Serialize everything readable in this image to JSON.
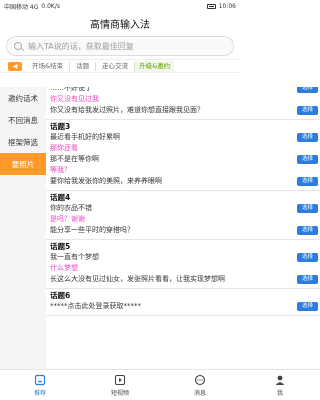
{
  "status_bar": {
    "carrier": "中国移动 4G",
    "network": "0.0K/s",
    "battery": "",
    "time": "10:06"
  },
  "app": {
    "title": "高情商输入法"
  },
  "search": {
    "placeholder": "输入TA说的话，获取最佳回复"
  },
  "tabs": [
    {
      "label": "开场&结束"
    },
    {
      "label": "话题"
    },
    {
      "label": "走心交流"
    },
    {
      "label": "升级&邀约"
    }
  ],
  "sidebar": [
    {
      "label": "邀约话术"
    },
    {
      "label": "不回消息"
    },
    {
      "label": "框架筛选"
    },
    {
      "label": "要照片"
    }
  ],
  "topics": [
    {
      "title": "",
      "lines": [
        {
          "kind": "q",
          "text": "……不好使了",
          "has_button": true
        },
        {
          "kind": "a",
          "text": "你又没有见过我",
          "has_button": false
        },
        {
          "kind": "q",
          "text": "你又没有给我发过照片，难道你想直接跟我见面？",
          "has_button": true
        }
      ]
    },
    {
      "title": "话题3",
      "lines": [
        {
          "kind": "q",
          "text": "最近看手机好的好累啊",
          "has_button": true
        },
        {
          "kind": "a",
          "text": "那你还看",
          "has_button": false
        },
        {
          "kind": "q",
          "text": "那不是在等你啊",
          "has_button": true
        },
        {
          "kind": "a",
          "text": "等我？",
          "has_button": false
        },
        {
          "kind": "q",
          "text": "要你给我发张你的美照，来养养眼啊",
          "has_button": true
        }
      ]
    },
    {
      "title": "话题4",
      "lines": [
        {
          "kind": "q",
          "text": "你的衣品不错",
          "has_button": true
        },
        {
          "kind": "a",
          "text": "是吗？谢谢",
          "has_button": false
        },
        {
          "kind": "q",
          "text": "能分享一些平时的穿搭吗？",
          "has_button": true
        }
      ]
    },
    {
      "title": "话题5",
      "lines": [
        {
          "kind": "q",
          "text": "我一直有个梦想",
          "has_button": true
        },
        {
          "kind": "a",
          "text": "什么梦想",
          "has_button": false
        },
        {
          "kind": "q",
          "text": "长这么大没有见过仙女，发张照片看看，让我实现梦想啊",
          "has_button": true
        }
      ]
    },
    {
      "title": "话题6",
      "lines": [
        {
          "kind": "q",
          "text": "*****点击此处登录获取*****",
          "has_button": true
        }
      ]
    }
  ],
  "select_label": "选择",
  "bottom_nav": [
    {
      "label": "推荐",
      "icon": "home-icon"
    },
    {
      "label": "短视频",
      "icon": "video-icon"
    },
    {
      "label": "消息",
      "icon": "message-icon"
    },
    {
      "label": "我",
      "icon": "person-icon"
    }
  ]
}
